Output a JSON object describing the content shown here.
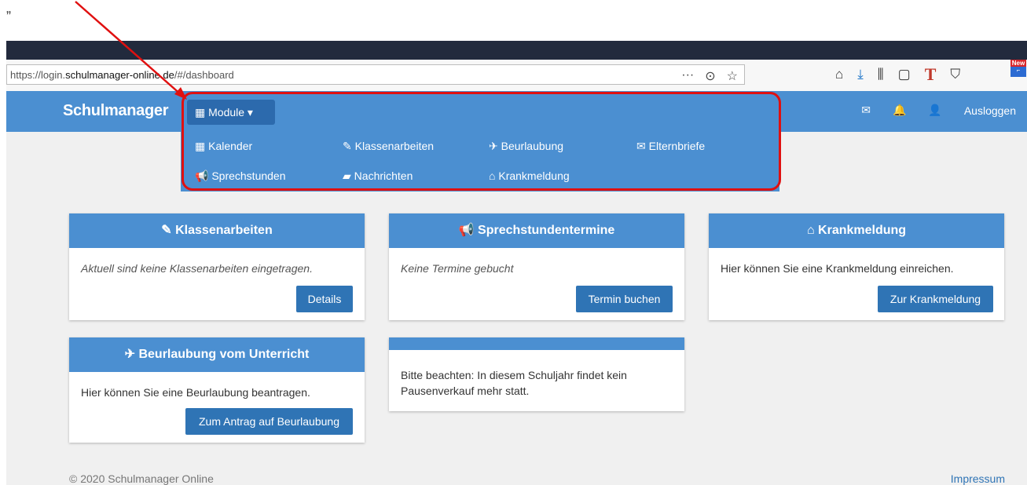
{
  "annotation": {
    "quote_mark": "„"
  },
  "browser": {
    "url_prefix": "https://login.",
    "url_host": "schulmanager-online.de",
    "url_path": "/#/dashboard",
    "page_actions": [
      "···",
      "⊙",
      "☆"
    ],
    "toolbar_icons": [
      "⌂",
      "⤓",
      "⫼",
      "▢",
      "T",
      "⛉"
    ],
    "new_badge": "New"
  },
  "navbar": {
    "brand": "Schulmanager",
    "module_label": "Module ▾",
    "right": [
      "✉",
      "🔔",
      "👤",
      "Ausloggen"
    ]
  },
  "module_menu": {
    "items": [
      {
        "label": "Kalender",
        "icon": "calendar-icon",
        "glyph": "▦"
      },
      {
        "label": "Klassenarbeiten",
        "icon": "edit-icon",
        "glyph": "✎"
      },
      {
        "label": "Beurlaubung",
        "icon": "pin-icon",
        "glyph": "✈"
      },
      {
        "label": "Elternbriefe",
        "icon": "envelope-icon",
        "glyph": "✉"
      },
      {
        "label": "Sprechstunden",
        "icon": "megaphone-icon",
        "glyph": "📢"
      },
      {
        "label": "Nachrichten",
        "icon": "comment-icon",
        "glyph": "▰"
      },
      {
        "label": "Krankmeldung",
        "icon": "home-icon",
        "glyph": "⌂"
      }
    ]
  },
  "cards": {
    "klassenarbeiten": {
      "title": "✎ Klassenarbeiten",
      "text": "Aktuell sind keine Klassenarbeiten eingetragen.",
      "button": "Details"
    },
    "sprechstunden": {
      "title": "📢 Sprechstundentermine",
      "text": "Keine Termine gebucht",
      "button": "Termin buchen"
    },
    "krankmeldung": {
      "title": "⌂ Krankmeldung",
      "text": "Hier können Sie eine Krankmeldung einreichen.",
      "button": "Zur Krankmeldung"
    },
    "beurlaubung": {
      "title": "✈ Beurlaubung vom Unterricht",
      "text": "Hier können Sie eine Beurlaubung beantragen.",
      "button": "Zum Antrag auf Beurlaubung"
    },
    "notice": {
      "text": "Bitte beachten: In diesem Schuljahr findet kein Pausenverkauf mehr statt."
    }
  },
  "footer": {
    "copyright": "© 2020 Schulmanager Online",
    "impressum": "Impressum"
  },
  "colors": {
    "primary": "#4b8fd1",
    "button": "#2f74b5",
    "highlight": "#e01010"
  }
}
